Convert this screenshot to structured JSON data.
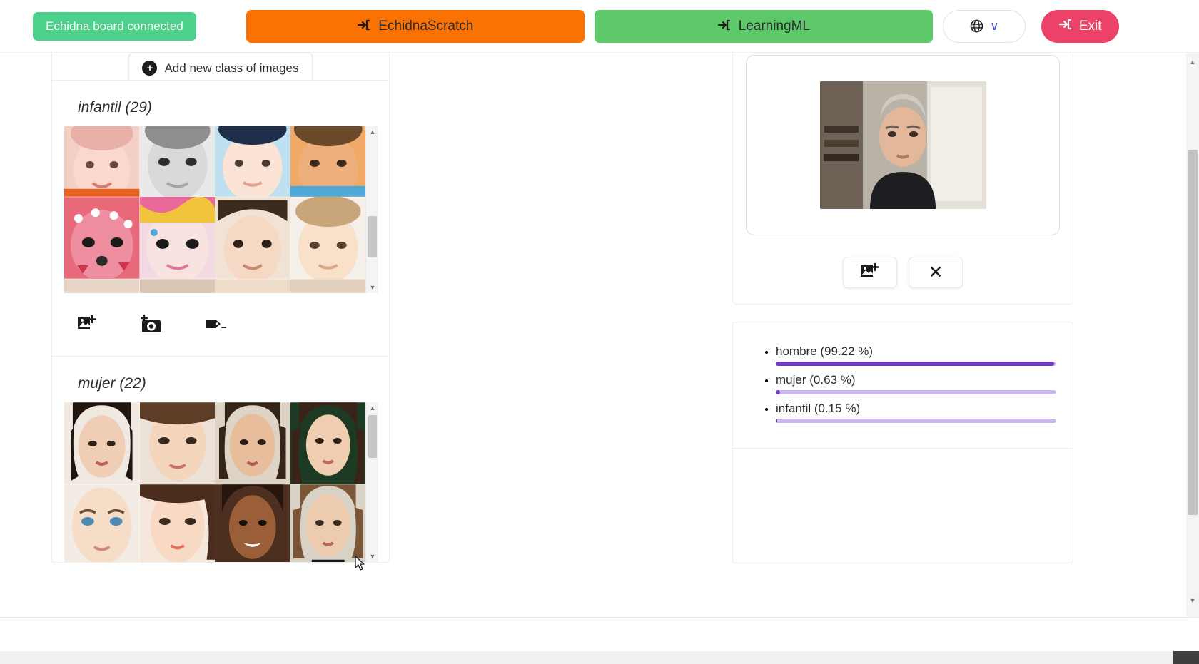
{
  "header": {
    "board_status": "Echidna board connected",
    "board_status_color": "#4cd08a",
    "scratch_label": "EchidnaScratch",
    "scratch_color": "#f97203",
    "learningml_label": "LearningML",
    "learningml_color": "#5dc96a",
    "login_icon": "→]",
    "language_icon": "globe-icon",
    "language_chevron": "∨",
    "exit_label": "Exit",
    "exit_color": "#ec4268"
  },
  "left_panel": {
    "add_class_label": "Add new class of images",
    "add_class_icon": "+",
    "classes": [
      {
        "name": "infantil",
        "count": "29",
        "title": "infantil (29)",
        "actions": [
          {
            "icon": "add-image-icon",
            "label": "Add image from file"
          },
          {
            "icon": "add-photo-camera-icon",
            "label": "Take photo with webcam"
          },
          {
            "icon": "rename-tag-icon",
            "label": "Rename class"
          }
        ]
      },
      {
        "name": "mujer",
        "count": "22",
        "title": "mujer (22)",
        "actions": [
          {
            "icon": "add-image-icon",
            "label": "Add image from file"
          },
          {
            "icon": "add-photo-camera-icon",
            "label": "Take photo with webcam"
          },
          {
            "icon": "rename-tag-icon",
            "label": "Rename class"
          }
        ]
      }
    ]
  },
  "right_panel": {
    "webcam_alt": "webcam-preview",
    "actions": [
      {
        "icon": "add-image-icon",
        "label": "Load image"
      },
      {
        "icon": "close-icon",
        "label": "✕"
      }
    ]
  },
  "chart_data": {
    "type": "bar",
    "title": "",
    "categories": [
      "hombre",
      "mujer",
      "infantil"
    ],
    "values": [
      99.22,
      0.63,
      0.15
    ],
    "labels": [
      "hombre (99.22 %)",
      "mujer (0.63 %)",
      "infantil (0.15 %)"
    ],
    "xlabel": "",
    "ylabel": "",
    "ylim": [
      0,
      100
    ],
    "unit": "%",
    "bar_color": "#6f36c8",
    "track_color": "#cdb8ee",
    "orientation": "horizontal",
    "legend": "none",
    "grid": false
  }
}
